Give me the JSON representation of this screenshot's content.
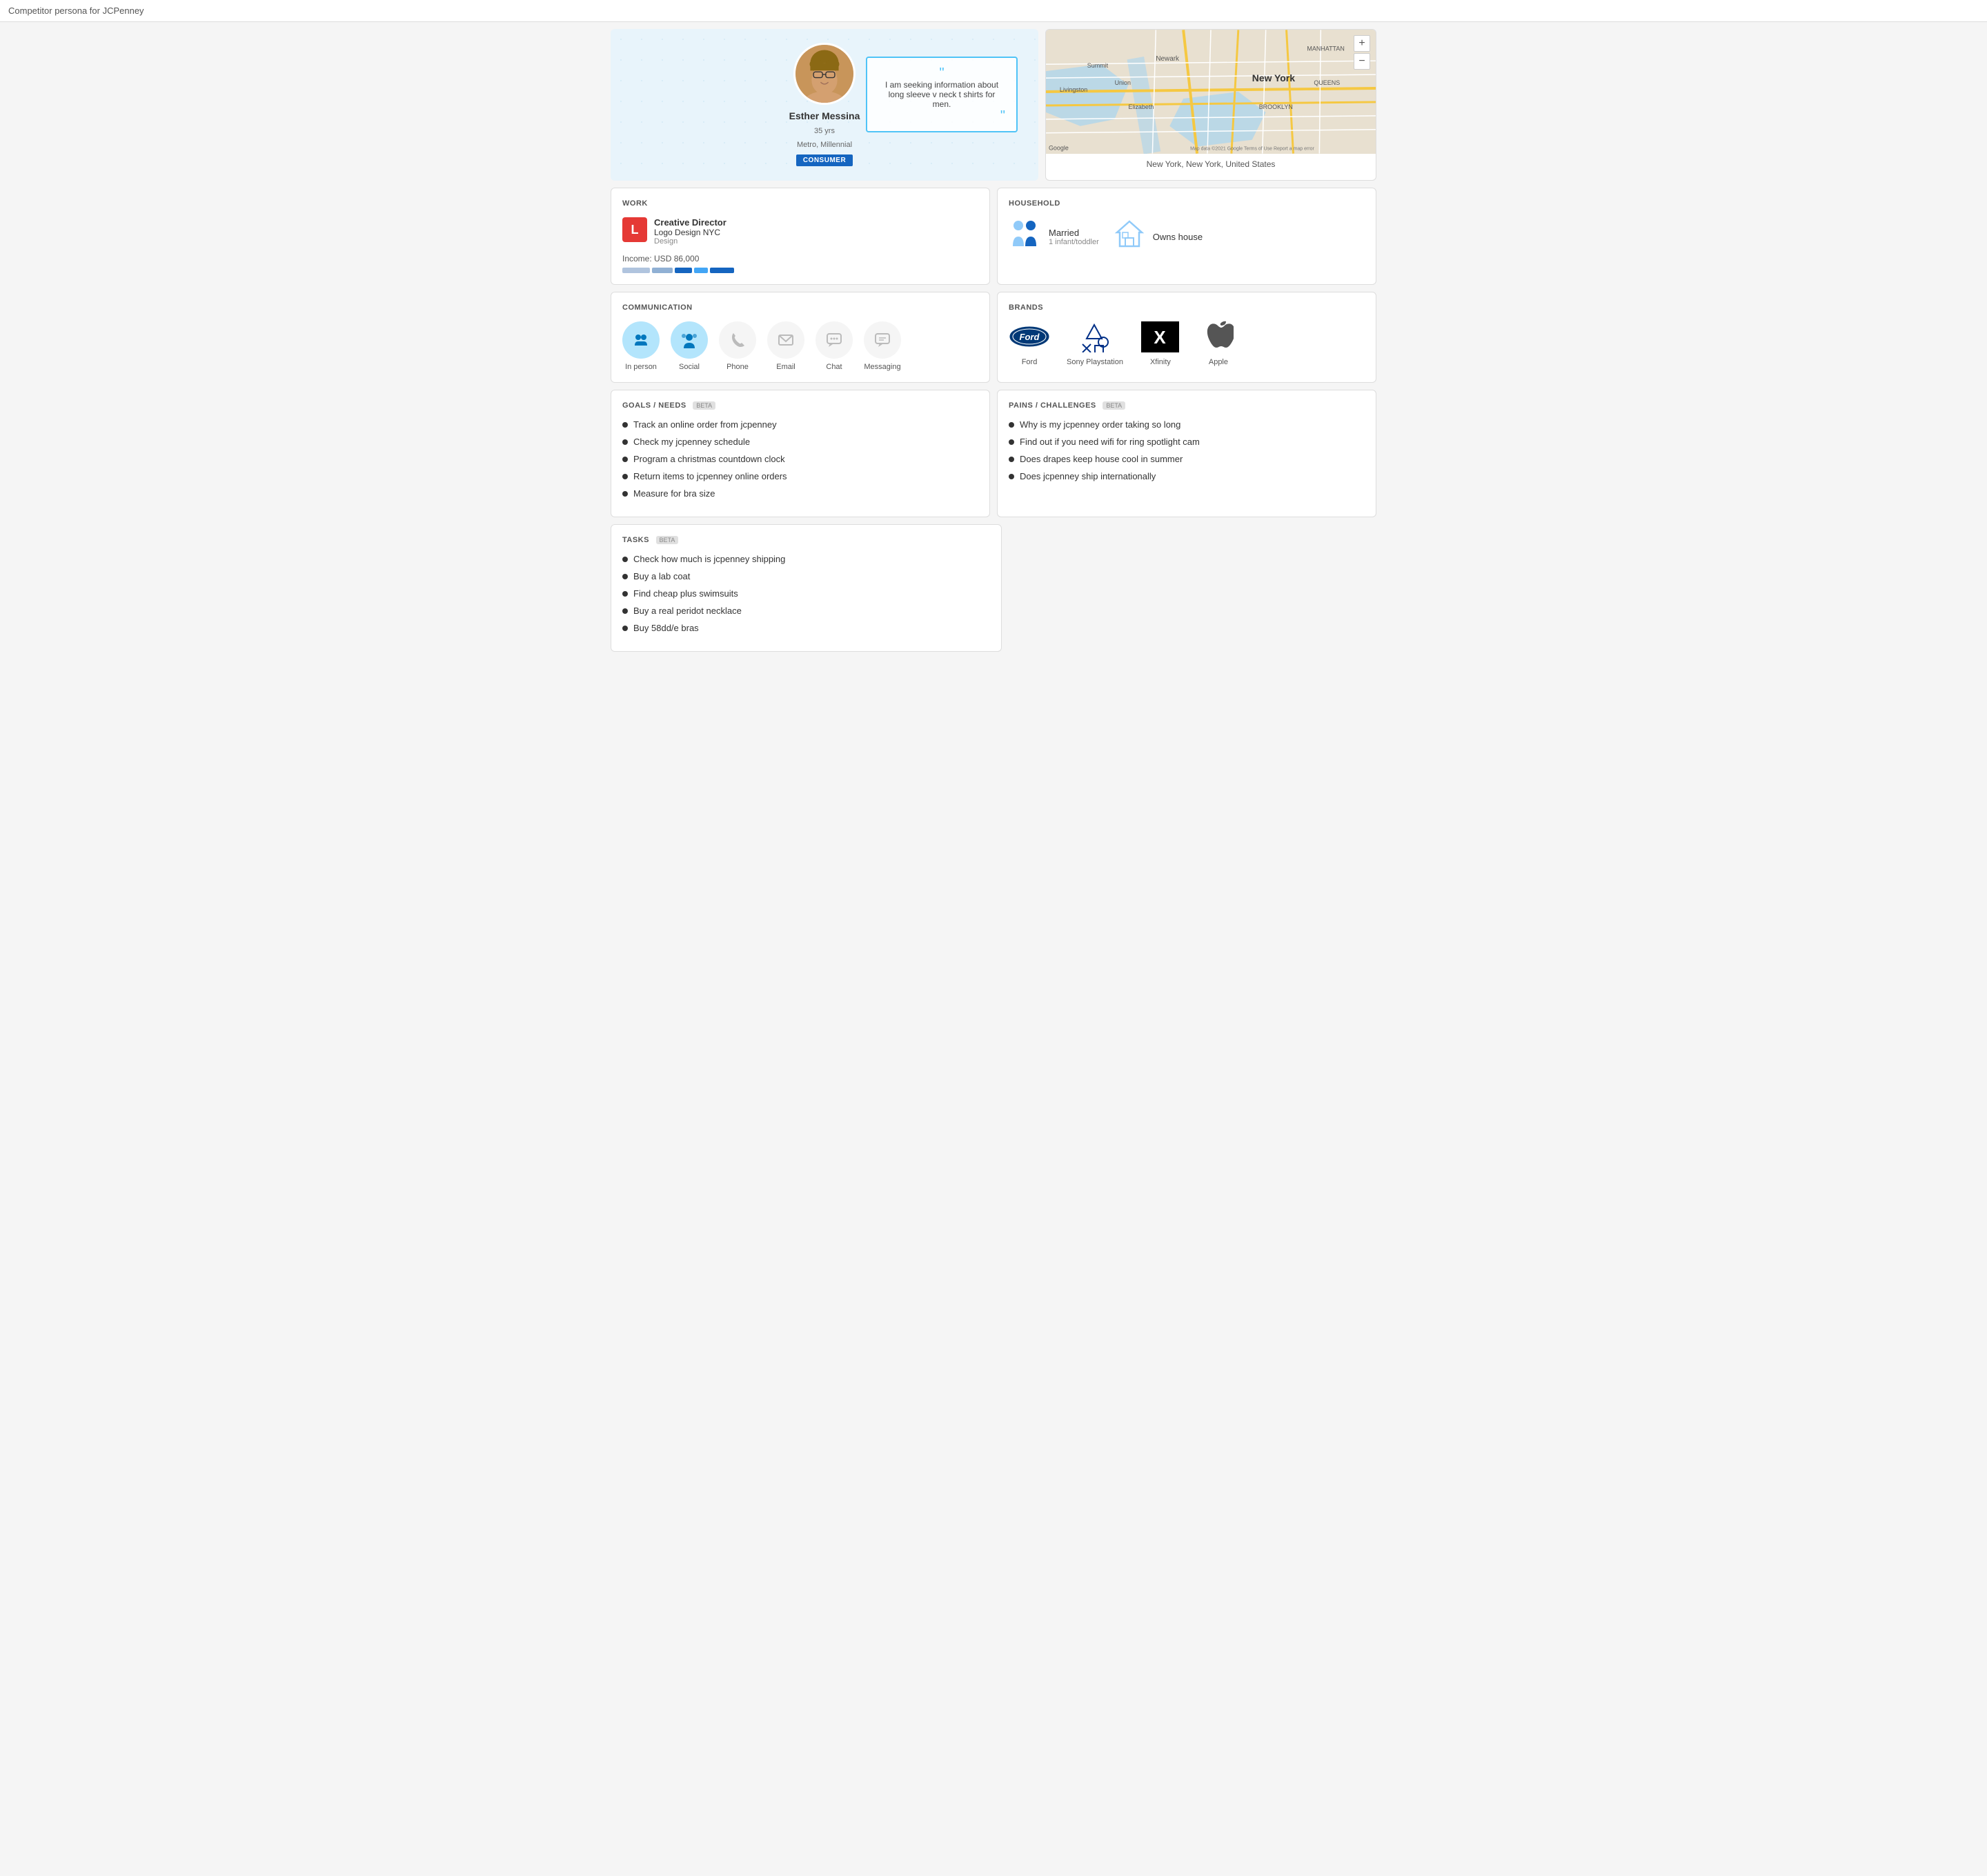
{
  "pageTitle": "Competitor persona for JCPenney",
  "hero": {
    "name": "Esther Messina",
    "age": "35 yrs",
    "location": "Metro, Millennial",
    "badge": "CONSUMER",
    "quote": "I am seeking information about long sleeve v neck t shirts for men."
  },
  "map": {
    "location": "New York, New York, United States"
  },
  "work": {
    "title": "WORK",
    "jobTitle": "Creative Director",
    "companyName": "Logo Design NYC",
    "department": "Design",
    "incomeLabel": "Income: USD 86,000",
    "logoLetter": "L"
  },
  "household": {
    "title": "HOUSEHOLD",
    "status": "Married",
    "statusSub": "1 infant/toddler",
    "ownership": "Owns house"
  },
  "communication": {
    "title": "COMMUNICATION",
    "items": [
      {
        "label": "In person",
        "active": true,
        "icon": "🤝"
      },
      {
        "label": "Social",
        "active": true,
        "icon": "👤"
      },
      {
        "label": "Phone",
        "active": false,
        "icon": "📞"
      },
      {
        "label": "Email",
        "active": false,
        "icon": "✉"
      },
      {
        "label": "Chat",
        "active": false,
        "icon": "💬"
      },
      {
        "label": "Messaging",
        "active": false,
        "icon": "🗨"
      }
    ]
  },
  "brands": {
    "title": "BRANDS",
    "items": [
      {
        "name": "Ford",
        "type": "ford"
      },
      {
        "name": "Sony Playstation",
        "type": "playstation"
      },
      {
        "name": "Xfinity",
        "type": "xfinity"
      },
      {
        "name": "Apple",
        "type": "apple"
      }
    ]
  },
  "goals": {
    "title": "GOALS / NEEDS",
    "beta": "BETA",
    "items": [
      "Track an online order from jcpenney",
      "Check my jcpenney schedule",
      "Program a christmas countdown clock",
      "Return items to jcpenney online orders",
      "Measure for bra size"
    ]
  },
  "pains": {
    "title": "PAINS / CHALLENGES",
    "beta": "BETA",
    "items": [
      "Why is my jcpenney order taking so long",
      "Find out if you need wifi for ring spotlight cam",
      "Does drapes keep house cool in summer",
      "Does jcpenney ship internationally"
    ]
  },
  "tasks": {
    "title": "TASKS",
    "beta": "BETA",
    "items": [
      "Check how much is jcpenney shipping",
      "Buy a lab coat",
      "Find cheap plus swimsuits",
      "Buy a real peridot necklace",
      "Buy 58dd/e bras"
    ]
  }
}
